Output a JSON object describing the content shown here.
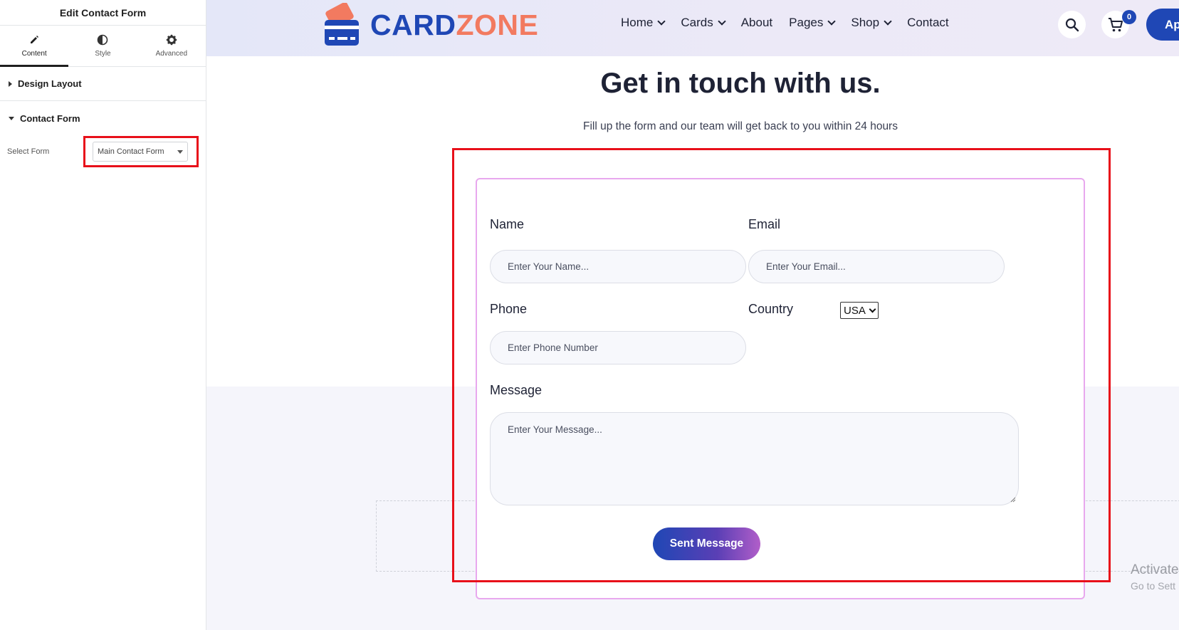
{
  "editor": {
    "title": "Edit Contact Form",
    "tabs": [
      {
        "label": "Content",
        "icon": "pencil-icon"
      },
      {
        "label": "Style",
        "icon": "contrast-icon"
      },
      {
        "label": "Advanced",
        "icon": "gear-icon"
      }
    ],
    "sections": {
      "design_layout": "Design Layout",
      "contact_form": "Contact Form"
    },
    "select_form": {
      "label": "Select Form",
      "value": "Main Contact Form"
    },
    "collapse_glyph": "‹"
  },
  "site": {
    "logo": {
      "part1": "CARD",
      "part2": "ZONE"
    },
    "menu": [
      {
        "label": "Home",
        "dropdown": true
      },
      {
        "label": "Cards",
        "dropdown": true
      },
      {
        "label": "About",
        "dropdown": false
      },
      {
        "label": "Pages",
        "dropdown": true
      },
      {
        "label": "Shop",
        "dropdown": true
      },
      {
        "label": "Contact",
        "dropdown": false
      }
    ],
    "cart_count": "0",
    "apply_label": "Ap",
    "colors": {
      "brand_blue": "#1f47b5",
      "brand_coral": "#f27a60",
      "highlight_red": "#e8101a"
    }
  },
  "contact": {
    "headline": "Get in touch with us.",
    "subtitle": "Fill up the form and our team will get back to you within 24 hours",
    "fields": {
      "name": {
        "label": "Name",
        "placeholder": "Enter Your Name..."
      },
      "email": {
        "label": "Email",
        "placeholder": "Enter Your Email..."
      },
      "phone": {
        "label": "Phone",
        "placeholder": "Enter Phone Number"
      },
      "country": {
        "label": "Country",
        "value": "USA"
      },
      "message": {
        "label": "Message",
        "placeholder": "Enter Your Message..."
      }
    },
    "submit_label": "Sent Message"
  },
  "watermark": {
    "line1": "Activate",
    "line2": "Go to Sett"
  }
}
